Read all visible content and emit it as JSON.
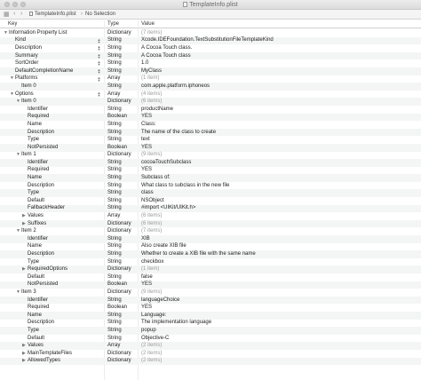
{
  "window": {
    "title": "TemplateInfo.plist"
  },
  "pathbar": {
    "file_label": "TemplateInfo.plist",
    "selection_label": "No Selection"
  },
  "columns": {
    "key": "Key",
    "type": "Type",
    "value": "Value"
  },
  "rows": [
    {
      "key": "Information Property List",
      "indent": 0,
      "disclosure": "open",
      "type": "Dictionary",
      "value": "(7 items)",
      "dim": true,
      "stepper": false
    },
    {
      "key": "Kind",
      "indent": 1,
      "disclosure": "none",
      "type": "String",
      "value": "Xcode.IDEFoundation.TextSubstitutionFileTemplateKind",
      "dim": false,
      "stepper": true
    },
    {
      "key": "Description",
      "indent": 1,
      "disclosure": "none",
      "type": "String",
      "value": "A Cocoa Touch class.",
      "dim": false,
      "stepper": true
    },
    {
      "key": "Summary",
      "indent": 1,
      "disclosure": "none",
      "type": "String",
      "value": "A Cocoa Touch class",
      "dim": false,
      "stepper": true
    },
    {
      "key": "SortOrder",
      "indent": 1,
      "disclosure": "none",
      "type": "String",
      "value": "1.0",
      "dim": false,
      "stepper": true
    },
    {
      "key": "DefaultCompletionName",
      "indent": 1,
      "disclosure": "none",
      "type": "String",
      "value": "MyClass",
      "dim": false,
      "stepper": true
    },
    {
      "key": "Platforms",
      "indent": 1,
      "disclosure": "open",
      "type": "Array",
      "value": "(1 item)",
      "dim": true,
      "stepper": true
    },
    {
      "key": "Item 0",
      "indent": 2,
      "disclosure": "none",
      "type": "String",
      "value": "com.apple.platform.iphoneos",
      "dim": false,
      "stepper": false
    },
    {
      "key": "Options",
      "indent": 1,
      "disclosure": "open",
      "type": "Array",
      "value": "(4 items)",
      "dim": true,
      "stepper": true
    },
    {
      "key": "Item 0",
      "indent": 2,
      "disclosure": "open",
      "type": "Dictionary",
      "value": "(6 items)",
      "dim": true,
      "stepper": false
    },
    {
      "key": "Identifier",
      "indent": 3,
      "disclosure": "none",
      "type": "String",
      "value": "productName",
      "dim": false,
      "stepper": false
    },
    {
      "key": "Required",
      "indent": 3,
      "disclosure": "none",
      "type": "Boolean",
      "value": "YES",
      "dim": false,
      "stepper": false
    },
    {
      "key": "Name",
      "indent": 3,
      "disclosure": "none",
      "type": "String",
      "value": "Class:",
      "dim": false,
      "stepper": false
    },
    {
      "key": "Description",
      "indent": 3,
      "disclosure": "none",
      "type": "String",
      "value": "The name of the class to create",
      "dim": false,
      "stepper": false
    },
    {
      "key": "Type",
      "indent": 3,
      "disclosure": "none",
      "type": "String",
      "value": "text",
      "dim": false,
      "stepper": false
    },
    {
      "key": "NotPersisted",
      "indent": 3,
      "disclosure": "none",
      "type": "Boolean",
      "value": "YES",
      "dim": false,
      "stepper": false
    },
    {
      "key": "Item 1",
      "indent": 2,
      "disclosure": "open",
      "type": "Dictionary",
      "value": "(9 items)",
      "dim": true,
      "stepper": false
    },
    {
      "key": "Identifier",
      "indent": 3,
      "disclosure": "none",
      "type": "String",
      "value": "cocoaTouchSubclass",
      "dim": false,
      "stepper": false
    },
    {
      "key": "Required",
      "indent": 3,
      "disclosure": "none",
      "type": "String",
      "value": "YES",
      "dim": false,
      "stepper": false
    },
    {
      "key": "Name",
      "indent": 3,
      "disclosure": "none",
      "type": "String",
      "value": "Subclass of:",
      "dim": false,
      "stepper": false
    },
    {
      "key": "Description",
      "indent": 3,
      "disclosure": "none",
      "type": "String",
      "value": "What class to subclass in the new file",
      "dim": false,
      "stepper": false
    },
    {
      "key": "Type",
      "indent": 3,
      "disclosure": "none",
      "type": "String",
      "value": "class",
      "dim": false,
      "stepper": false
    },
    {
      "key": "Default",
      "indent": 3,
      "disclosure": "none",
      "type": "String",
      "value": "NSObject",
      "dim": false,
      "stepper": false
    },
    {
      "key": "FallbackHeader",
      "indent": 3,
      "disclosure": "none",
      "type": "String",
      "value": "#import <UIKit/UIKit.h>",
      "dim": false,
      "stepper": false
    },
    {
      "key": "Values",
      "indent": 3,
      "disclosure": "closed",
      "type": "Array",
      "value": "(6 items)",
      "dim": true,
      "stepper": false
    },
    {
      "key": "Suffixes",
      "indent": 3,
      "disclosure": "closed",
      "type": "Dictionary",
      "value": "(6 items)",
      "dim": true,
      "stepper": false
    },
    {
      "key": "Item 2",
      "indent": 2,
      "disclosure": "open",
      "type": "Dictionary",
      "value": "(7 items)",
      "dim": true,
      "stepper": false
    },
    {
      "key": "Identifier",
      "indent": 3,
      "disclosure": "none",
      "type": "String",
      "value": "XIB",
      "dim": false,
      "stepper": false
    },
    {
      "key": "Name",
      "indent": 3,
      "disclosure": "none",
      "type": "String",
      "value": "Also create XIB file",
      "dim": false,
      "stepper": false
    },
    {
      "key": "Description",
      "indent": 3,
      "disclosure": "none",
      "type": "String",
      "value": "Whether to create a XIB file with the same name",
      "dim": false,
      "stepper": false
    },
    {
      "key": "Type",
      "indent": 3,
      "disclosure": "none",
      "type": "String",
      "value": "checkbox",
      "dim": false,
      "stepper": false
    },
    {
      "key": "RequiredOptions",
      "indent": 3,
      "disclosure": "closed",
      "type": "Dictionary",
      "value": "(1 item)",
      "dim": true,
      "stepper": false
    },
    {
      "key": "Default",
      "indent": 3,
      "disclosure": "none",
      "type": "String",
      "value": "false",
      "dim": false,
      "stepper": false
    },
    {
      "key": "NotPersisted",
      "indent": 3,
      "disclosure": "none",
      "type": "Boolean",
      "value": "YES",
      "dim": false,
      "stepper": false
    },
    {
      "key": "Item 3",
      "indent": 2,
      "disclosure": "open",
      "type": "Dictionary",
      "value": "(9 items)",
      "dim": true,
      "stepper": false
    },
    {
      "key": "Identifier",
      "indent": 3,
      "disclosure": "none",
      "type": "String",
      "value": "languageChoice",
      "dim": false,
      "stepper": false
    },
    {
      "key": "Required",
      "indent": 3,
      "disclosure": "none",
      "type": "Boolean",
      "value": "YES",
      "dim": false,
      "stepper": false
    },
    {
      "key": "Name",
      "indent": 3,
      "disclosure": "none",
      "type": "String",
      "value": "Language:",
      "dim": false,
      "stepper": false
    },
    {
      "key": "Description",
      "indent": 3,
      "disclosure": "none",
      "type": "String",
      "value": "The implementation language",
      "dim": false,
      "stepper": false
    },
    {
      "key": "Type",
      "indent": 3,
      "disclosure": "none",
      "type": "String",
      "value": "popup",
      "dim": false,
      "stepper": false
    },
    {
      "key": "Default",
      "indent": 3,
      "disclosure": "none",
      "type": "String",
      "value": "Objective-C",
      "dim": false,
      "stepper": false
    },
    {
      "key": "Values",
      "indent": 3,
      "disclosure": "closed",
      "type": "Array",
      "value": "(2 items)",
      "dim": true,
      "stepper": false
    },
    {
      "key": "MainTemplateFiles",
      "indent": 3,
      "disclosure": "closed",
      "type": "Dictionary",
      "value": "(2 items)",
      "dim": true,
      "stepper": false
    },
    {
      "key": "AllowedTypes",
      "indent": 3,
      "disclosure": "closed",
      "type": "Dictionary",
      "value": "(2 items)",
      "dim": true,
      "stepper": false
    }
  ]
}
